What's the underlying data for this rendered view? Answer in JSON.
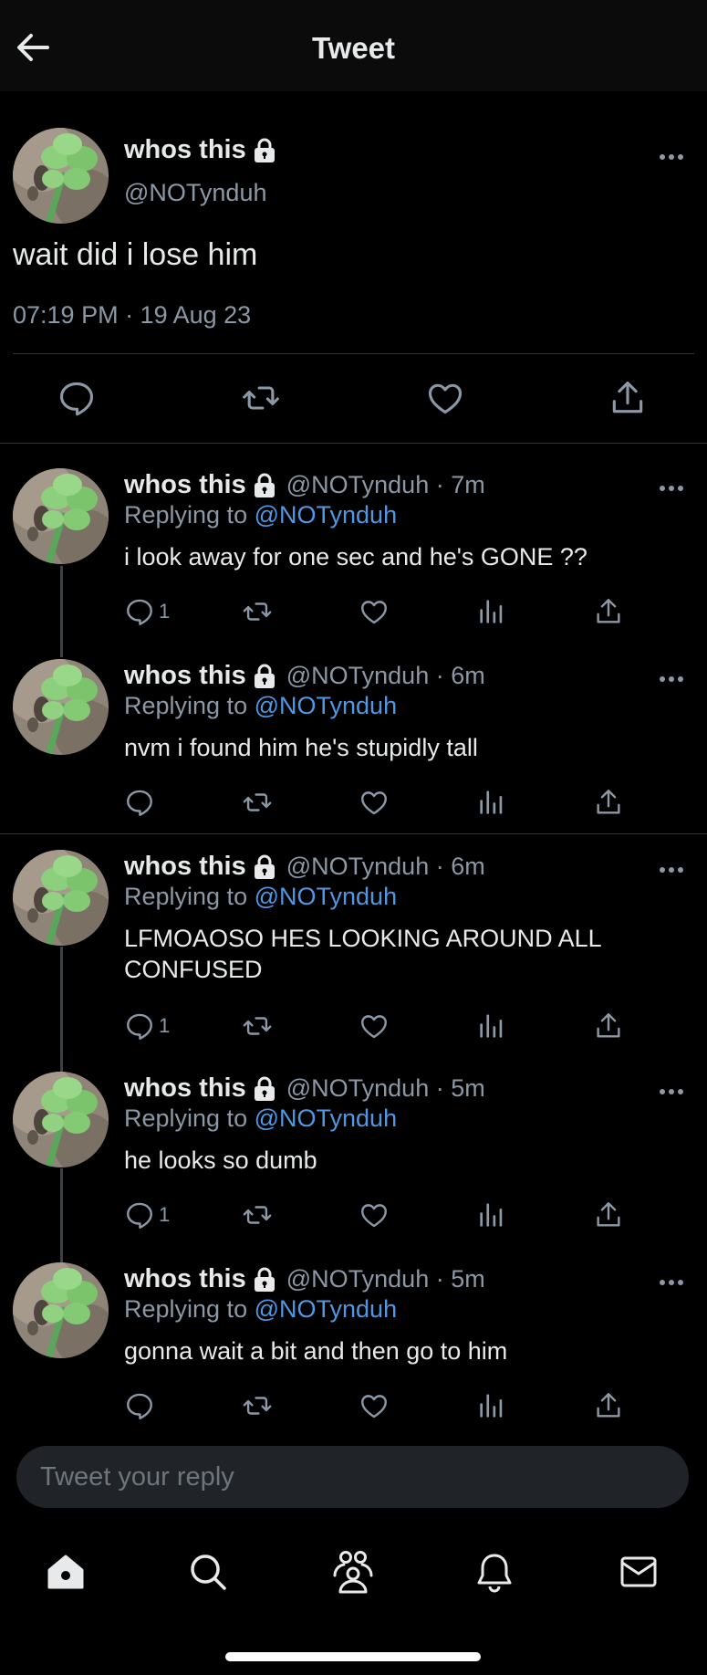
{
  "header": {
    "title": "Tweet"
  },
  "main_tweet": {
    "name": "whos this",
    "handle": "@NOTynduh",
    "text": "wait did i lose him",
    "timestamp": "07:19 PM · 19 Aug 23",
    "actions": [
      "reply-icon",
      "retweet-icon",
      "like-icon",
      "share-icon"
    ]
  },
  "replies": [
    {
      "name": "whos this",
      "handle_time": "@NOTynduh · 7m",
      "replying_prefix": "Replying to",
      "replying_to": "@NOTynduh",
      "text": "i look away for one sec and he's GONE ??",
      "reply_count": "1"
    },
    {
      "name": "whos this",
      "handle_time": "@NOTynduh · 6m",
      "replying_prefix": "Replying to",
      "replying_to": "@NOTynduh",
      "text": "nvm i found him he's stupidly tall",
      "reply_count": ""
    },
    {
      "name": "whos this",
      "handle_time": "@NOTynduh · 6m",
      "replying_prefix": "Replying to",
      "replying_to": "@NOTynduh",
      "text": "LFMOAOSO HES LOOKING AROUND ALL CONFUSED",
      "reply_count": "1"
    },
    {
      "name": "whos this",
      "handle_time": "@NOTynduh · 5m",
      "replying_prefix": "Replying to",
      "replying_to": "@NOTynduh",
      "text": "he looks so dumb",
      "reply_count": "1"
    },
    {
      "name": "whos this",
      "handle_time": "@NOTynduh · 5m",
      "replying_prefix": "Replying to",
      "replying_to": "@NOTynduh",
      "text": "gonna wait a bit and then go to him",
      "reply_count": ""
    }
  ],
  "reply_input": {
    "placeholder": "Tweet your reply"
  },
  "bottom_nav": [
    "home-icon",
    "search-icon",
    "communities-icon",
    "notifications-icon",
    "messages-icon"
  ],
  "colors": {
    "background": "#000000",
    "text": "#e7e9ea",
    "secondary": "#8b98a5",
    "link": "#4f98e4",
    "divider": "#2f3336"
  }
}
